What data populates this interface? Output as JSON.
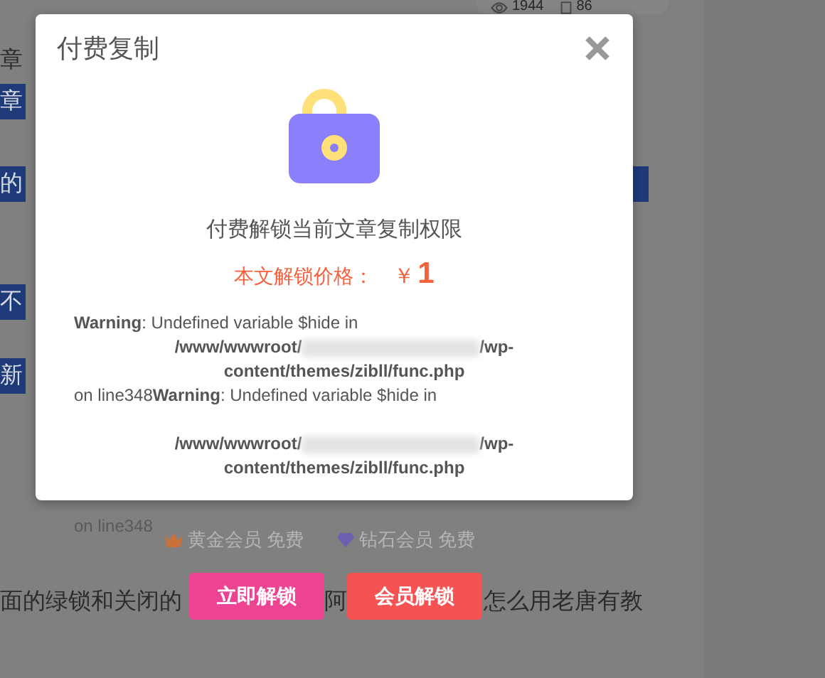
{
  "page": {
    "stats": [
      {
        "kind": "views",
        "value": "1944"
      },
      {
        "kind": "comments",
        "value": "86"
      }
    ],
    "fragments": [
      {
        "kind": "plain",
        "left": "章"
      },
      {
        "kind": "highlight",
        "left": "章"
      },
      {
        "kind": "highlight",
        "left": "的"
      },
      {
        "kind": "highlight",
        "left": "不"
      },
      {
        "kind": "highlight",
        "left": "新"
      }
    ],
    "trailing_text": "on line348",
    "member_prices": [
      {
        "kind": "gold",
        "label": "黄金会员 免费"
      },
      {
        "kind": "diamond",
        "label": "钻石会员 免费"
      }
    ],
    "bottom_line": [
      "面的绿锁和关闭的",
      "阿",
      "怎么用老唐有教"
    ]
  },
  "modal": {
    "title": "付费复制",
    "heading": "付费解锁当前文章复制权限",
    "price_label": "本文解锁价格：",
    "price_currency": "￥",
    "price_value": "1",
    "warnings": [
      {
        "label": "Warning",
        "message": ": Undefined variable $hide in",
        "path_start": "/www/wwwroot/",
        "path_end": "/wp-content/themes/zibll/func.php"
      },
      {
        "prefix": "on line348",
        "label": "Warning",
        "message": ": Undefined variable $hide in",
        "path_start": "/www/wwwroot/",
        "path_end": "/wp-content/themes/zibll/func.php"
      }
    ]
  },
  "buttons": [
    {
      "kind": "primary",
      "label": "立即解锁"
    },
    {
      "kind": "member",
      "label": "会员解锁"
    }
  ]
}
